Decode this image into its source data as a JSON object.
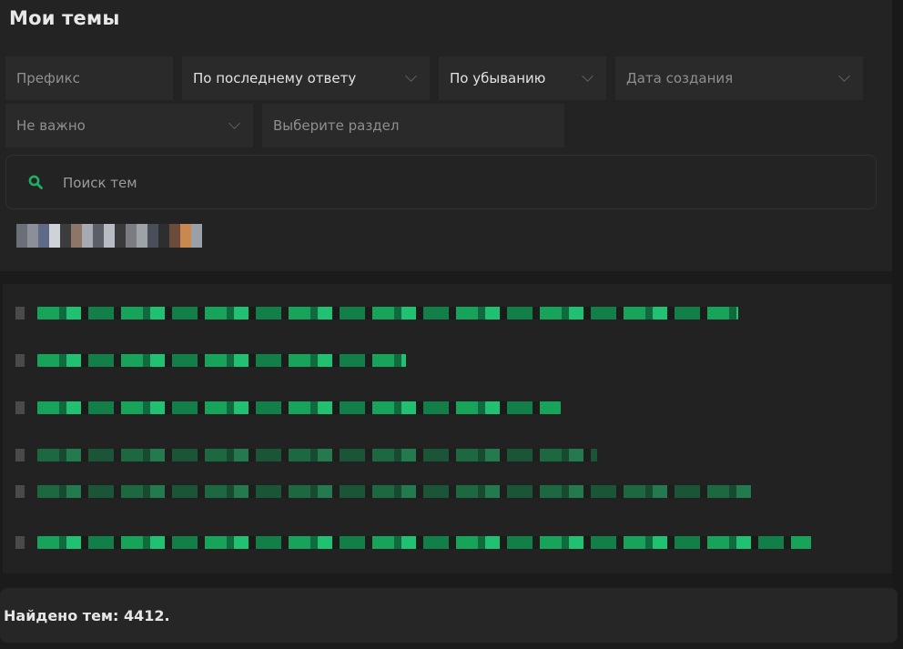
{
  "page": {
    "title": "Мои темы"
  },
  "filters": {
    "prefix_placeholder": "Префикс",
    "sort_by": "По последнему ответу",
    "order": "По убыванию",
    "date": "Дата создания",
    "importance": "Не важно",
    "section_placeholder": "Выберите раздел"
  },
  "search": {
    "placeholder": "Поиск тем",
    "icon": "search-icon"
  },
  "colors": {
    "accent": "#1fae66",
    "background": "#1b1b1b",
    "panel": "#232323"
  },
  "footer": {
    "found_text": "Найдено тем: 4412."
  }
}
